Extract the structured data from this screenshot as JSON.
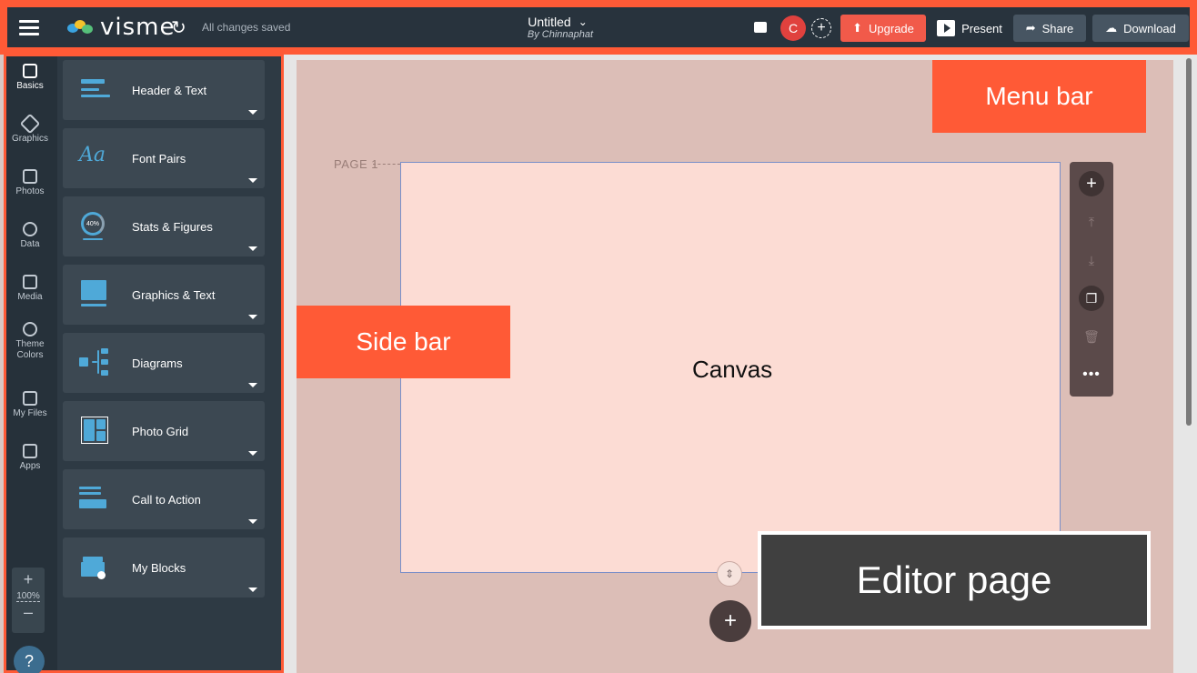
{
  "app": {
    "logo_text": "visme",
    "save_status": "All changes saved",
    "document_title": "Untitled",
    "document_author": "By Chinnaphat",
    "avatar_initial": "C"
  },
  "topbar_buttons": {
    "upgrade": "Upgrade",
    "present": "Present",
    "share": "Share",
    "download": "Download"
  },
  "sidebar": {
    "rail": [
      {
        "label": "Basics",
        "icon": "basics-icon",
        "active": true
      },
      {
        "label": "Graphics",
        "icon": "graphics-icon"
      },
      {
        "label": "Photos",
        "icon": "photos-icon"
      },
      {
        "label": "Data",
        "icon": "data-pie-icon"
      },
      {
        "label": "Media",
        "icon": "media-icon"
      },
      {
        "label": "Theme Colors",
        "icon": "palette-icon"
      },
      {
        "label": "My Files",
        "icon": "upload-folder-icon"
      },
      {
        "label": "Apps",
        "icon": "apps-grid-icon"
      }
    ],
    "zoom": "100%",
    "help": "?",
    "panel": [
      {
        "label": "Header & Text",
        "icon": "header-text-icon"
      },
      {
        "label": "Font Pairs",
        "icon": "font-pairs-icon"
      },
      {
        "label": "Stats & Figures",
        "icon": "stats-icon"
      },
      {
        "label": "Graphics & Text",
        "icon": "graphics-text-icon"
      },
      {
        "label": "Diagrams",
        "icon": "diagram-icon"
      },
      {
        "label": "Photo Grid",
        "icon": "photo-grid-icon"
      },
      {
        "label": "Call to Action",
        "icon": "call-to-action-icon"
      },
      {
        "label": "My Blocks",
        "icon": "my-blocks-icon"
      }
    ],
    "stats_icon_text": "40%",
    "font_pairs_glyph": "Aa"
  },
  "editor": {
    "page_label": "PAGE 1",
    "canvas_label": "Canvas"
  },
  "annotations": {
    "menu_bar": "Menu bar",
    "side_bar": "Side bar",
    "editor_page": "Editor page"
  },
  "colors": {
    "topbar_bg": "#28333d",
    "accent_orange": "#ff5a36",
    "upgrade_red": "#f15a4a",
    "canvas_bg": "#fcdcd4",
    "editor_bg": "#dcbeb7",
    "icon_blue": "#4fa9d8"
  }
}
